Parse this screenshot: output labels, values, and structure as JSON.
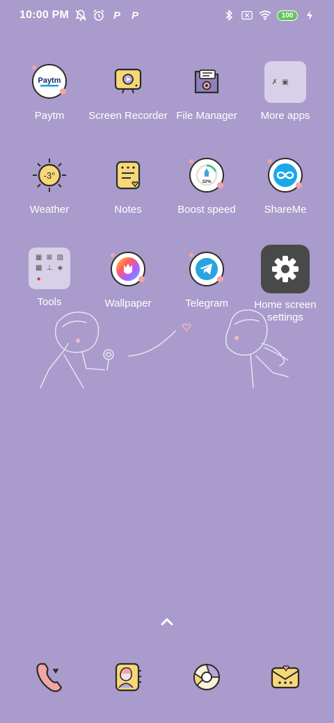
{
  "status_bar": {
    "time": "10:00 PM",
    "left_icons": [
      "notifications-off-icon",
      "alarm-icon",
      "paytm-p-icon",
      "paytm-p-icon"
    ],
    "p_glyph": "P",
    "right_icons": [
      "bluetooth-icon",
      "no-sim-icon",
      "wifi-icon",
      "battery-icon",
      "charging-icon"
    ],
    "battery_level": "100"
  },
  "apps": [
    {
      "label": "Paytm",
      "icon": "paytm-icon",
      "icon_text": "Paytm"
    },
    {
      "label": "Screen Recorder",
      "icon": "screen-recorder-icon"
    },
    {
      "label": "File Manager",
      "icon": "file-manager-icon"
    },
    {
      "label": "More apps",
      "icon": "folder-icon"
    },
    {
      "label": "Weather",
      "icon": "weather-icon",
      "icon_text": "-3°"
    },
    {
      "label": "Notes",
      "icon": "notes-icon"
    },
    {
      "label": "Boost speed",
      "icon": "boost-speed-icon",
      "icon_text": "32%"
    },
    {
      "label": "ShareMe",
      "icon": "shareme-icon"
    },
    {
      "label": "Tools",
      "icon": "folder-icon"
    },
    {
      "label": "Wallpaper",
      "icon": "wallpaper-icon"
    },
    {
      "label": "Telegram",
      "icon": "telegram-icon"
    },
    {
      "label": "Home screen settings",
      "icon": "gear-icon"
    }
  ],
  "dock": [
    "phone-icon",
    "contacts-icon",
    "browser-icon",
    "messages-icon"
  ],
  "colors": {
    "background": "#a99bcb",
    "battery": "#61c45a",
    "heart": "#f2a5a5",
    "settings_tile": "#494949"
  }
}
